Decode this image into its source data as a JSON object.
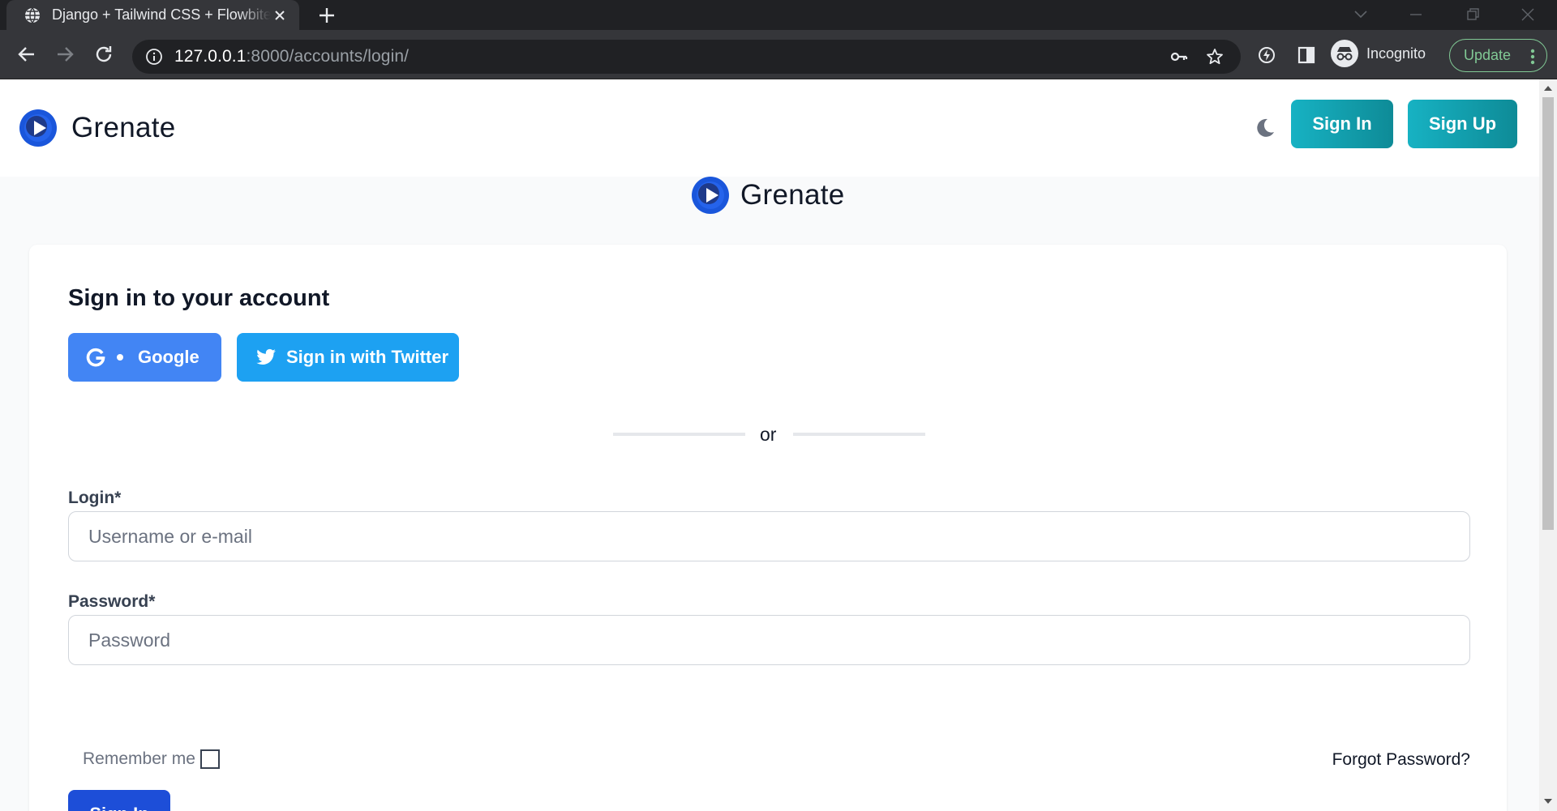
{
  "browser": {
    "tab_title": "Django + Tailwind CSS + Flowbite",
    "url_host": "127.0.0.1",
    "url_path": ":8000/accounts/login/",
    "profile_label": "Incognito",
    "update_label": "Update",
    "icons": [
      "globe-icon",
      "close-icon",
      "plus-icon",
      "chevron-down-icon",
      "minimize-icon",
      "restore-icon",
      "back-icon",
      "forward-icon",
      "reload-icon",
      "info-icon",
      "key-icon",
      "star-icon",
      "extension-icon",
      "side-panel-icon",
      "incognito-icon",
      "kebab-menu-icon"
    ]
  },
  "navbar": {
    "brand": "Grenate",
    "signin_label": "Sign In",
    "signup_label": "Sign Up"
  },
  "main": {
    "brand": "Grenate",
    "title": "Sign in to your account",
    "google_label": "Google",
    "twitter_label": "Sign in with Twitter",
    "or_label": "or",
    "login_label": "Login*",
    "login_placeholder": "Username or e-mail",
    "password_label": "Password*",
    "password_placeholder": "Password",
    "remember_label": "Remember me",
    "forgot_label": "Forgot Password?",
    "submit_label": "Sign In"
  },
  "colors": {
    "teal_start": "#17b2c3",
    "teal_end": "#0e8b97",
    "google_blue": "#4285f4",
    "twitter_blue": "#1da1f2",
    "primary_blue": "#1d4ed8"
  }
}
